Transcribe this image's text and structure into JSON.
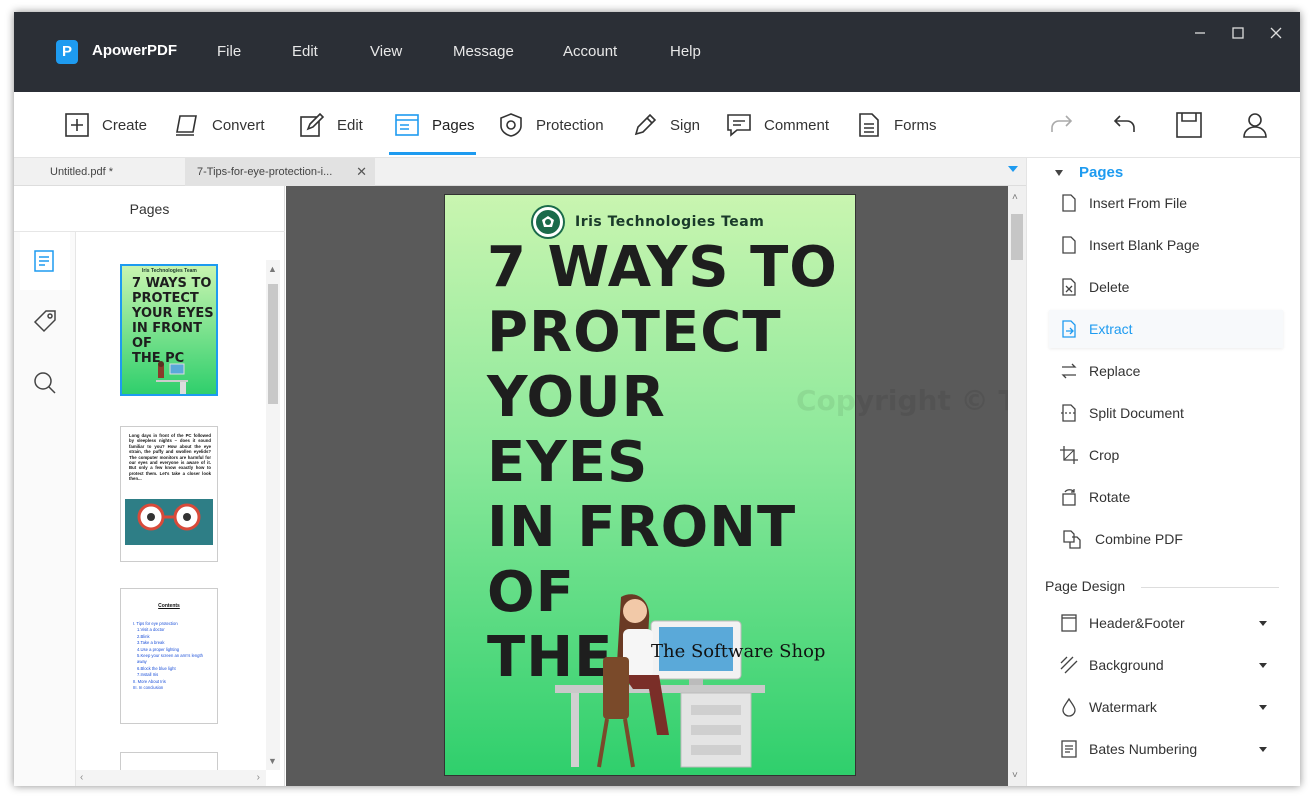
{
  "app": {
    "name": "ApowerPDF",
    "logo_letter": "P"
  },
  "menu": [
    "File",
    "Edit",
    "View",
    "Message",
    "Account",
    "Help"
  ],
  "toolbar": {
    "items": [
      {
        "label": "Create",
        "icon": "plus-square-icon"
      },
      {
        "label": "Convert",
        "icon": "convert-icon"
      },
      {
        "label": "Edit",
        "icon": "edit-icon"
      },
      {
        "label": "Pages",
        "icon": "pages-icon",
        "active": true
      },
      {
        "label": "Protection",
        "icon": "shield-icon"
      },
      {
        "label": "Sign",
        "icon": "pen-icon"
      },
      {
        "label": "Comment",
        "icon": "comment-icon"
      },
      {
        "label": "Forms",
        "icon": "forms-icon"
      }
    ],
    "right_icons": [
      "redo-icon",
      "undo-icon",
      "save-icon",
      "user-icon"
    ]
  },
  "tabs": [
    {
      "label": "Untitled.pdf *"
    },
    {
      "label": "7-Tips-for-eye-protection-i...",
      "selected": true
    }
  ],
  "left_panel": {
    "title": "Pages",
    "thumb2_text": "Long days in front of the PC followed by sleepless nights – does it sound familiar to you? How about the eye strain, the puffy and swollen eyelids? The computer monitors are harmful for our eyes and everyone is aware of it. But only a few know exactly how to protect them. Let's take a closer look then...",
    "thumb3_heading": "Contents",
    "thumb3_items": [
      "I.  Tips for eye protection",
      "1.Visit a doctor",
      "2.Blink",
      "3.Take a break",
      "4.Use a proper lighting",
      "5.Keep your screen an arm's length away",
      "6.Block the blue light",
      "7.Install Iris",
      "II.  More About Iris",
      "III.  In conclusion"
    ]
  },
  "document": {
    "brand": "Iris Technologies Team",
    "title_lines": [
      "7 WAYS TO",
      "PROTECT",
      "YOUR EYES",
      "IN FRONT OF",
      "THE PC"
    ],
    "watermark": "The Software Shop",
    "copyright": "Copyright © THESOFTWARE.SHOP"
  },
  "right_panel": {
    "heading": "Pages",
    "items": [
      {
        "label": "Insert From File"
      },
      {
        "label": "Insert Blank Page"
      },
      {
        "label": "Delete"
      },
      {
        "label": "Extract",
        "selected": true
      },
      {
        "label": "Replace"
      },
      {
        "label": "Split Document"
      },
      {
        "label": "Crop"
      },
      {
        "label": "Rotate"
      },
      {
        "label": "Combine PDF"
      }
    ],
    "section_title": "Page Design",
    "design_items": [
      {
        "label": "Header&Footer"
      },
      {
        "label": "Background"
      },
      {
        "label": "Watermark"
      },
      {
        "label": "Bates Numbering"
      }
    ]
  },
  "colors": {
    "accent": "#1e9bf0",
    "titlebar": "#2b2f36"
  }
}
